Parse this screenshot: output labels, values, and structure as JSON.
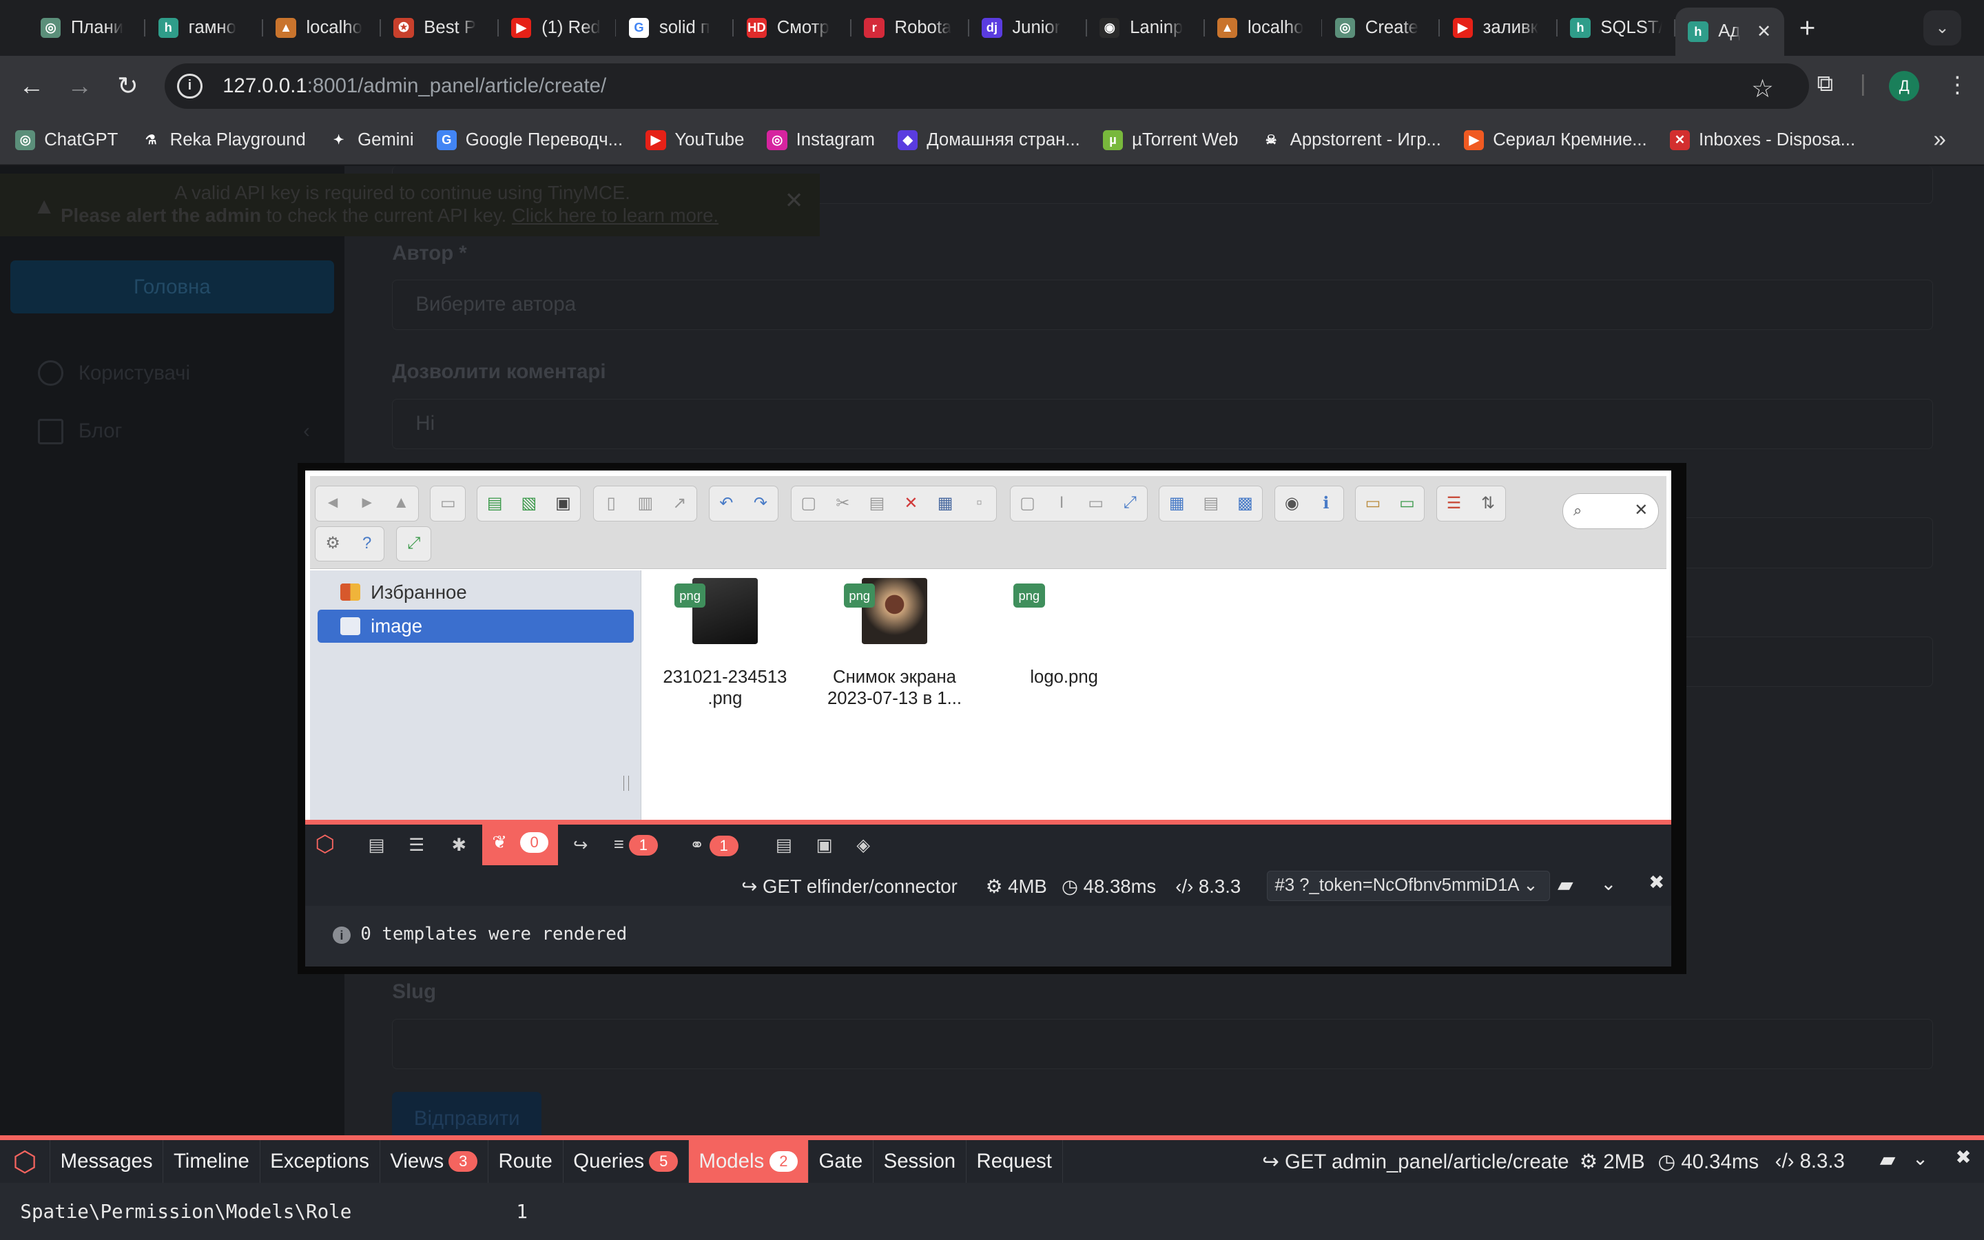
{
  "browser": {
    "tabs": [
      {
        "title": "Плани",
        "color": "#5b8f7a",
        "glyph": "◎"
      },
      {
        "title": "гамно",
        "color": "#2f9d8a",
        "glyph": "h"
      },
      {
        "title": "localho",
        "color": "#c9742d",
        "glyph": "▲"
      },
      {
        "title": "Best P",
        "color": "#c8402c",
        "glyph": "✪"
      },
      {
        "title": "(1) Red",
        "color": "#e62117",
        "glyph": "▶"
      },
      {
        "title": "solid п",
        "color": "#ffffff",
        "glyph": "G"
      },
      {
        "title": "Смотр",
        "color": "#e02b2b",
        "glyph": "HD"
      },
      {
        "title": "Robota",
        "color": "#d42a3a",
        "glyph": "r"
      },
      {
        "title": "Junior",
        "color": "#5a3ce0",
        "glyph": "dj"
      },
      {
        "title": "Laninp",
        "color": "#2b2b2b",
        "glyph": "◉"
      },
      {
        "title": "localho",
        "color": "#c9742d",
        "glyph": "▲"
      },
      {
        "title": "Create",
        "color": "#5b8f7a",
        "glyph": "◎"
      },
      {
        "title": "заливк",
        "color": "#e62117",
        "glyph": "▶"
      },
      {
        "title": "SQLST/",
        "color": "#2f9d8a",
        "glyph": "h"
      },
      {
        "title": "Ад",
        "color": "#2f9d8a",
        "glyph": "h",
        "active": true
      }
    ],
    "close_glyph": "✕",
    "newtab_glyph": "+",
    "url_host": "127.0.0.1",
    "url_rest": ":8001/admin_panel/article/create/",
    "avatar_letter": "Д",
    "bookmarks": [
      {
        "label": "ChatGPT",
        "color": "#5b8f7a",
        "glyph": "◎"
      },
      {
        "label": "Reka Playground",
        "color": "transparent",
        "glyph": "⚗"
      },
      {
        "label": "Gemini",
        "color": "transparent",
        "glyph": "✦"
      },
      {
        "label": "Google Переводч...",
        "color": "#4285f4",
        "glyph": "G"
      },
      {
        "label": "YouTube",
        "color": "#e62117",
        "glyph": "▶"
      },
      {
        "label": "Instagram",
        "color": "#d6249f",
        "glyph": "◎"
      },
      {
        "label": "Домашняя стран...",
        "color": "#5a3ce0",
        "glyph": "◆"
      },
      {
        "label": "µTorrent Web",
        "color": "#78b83c",
        "glyph": "µ"
      },
      {
        "label": "Appstorrent - Игр...",
        "color": "transparent",
        "glyph": "☠"
      },
      {
        "label": "Сериал Кремние...",
        "color": "#f05a22",
        "glyph": "▶"
      },
      {
        "label": "Inboxes - Disposa...",
        "color": "#d32f2f",
        "glyph": "✕"
      }
    ],
    "bookmarks_more": "»"
  },
  "tinymce_warning": {
    "line1": "A valid API key is required to continue using TinyMCE.",
    "line2_bold": "Please alert the admin",
    "line2_rest": " to check the current API key. ",
    "line2_link": "Click here to learn more."
  },
  "sidebar": {
    "home": "Головна",
    "users": "Користувачі",
    "blog": "Блог"
  },
  "form": {
    "author_label": "Автор *",
    "author_placeholder": "Виберите автора",
    "comments_label": "Дозволити коментарі",
    "comments_value": "Ні",
    "slug_label": "Slug",
    "submit": "Відправити"
  },
  "elfinder": {
    "tree": [
      {
        "label": "Избранное",
        "selected": false
      },
      {
        "label": "image",
        "selected": true
      }
    ],
    "files": [
      {
        "name": "231021-234513\n.png",
        "badge": "png",
        "thumb": "dark"
      },
      {
        "name": "Снимок экрана\n2023-07-13 в 1...",
        "badge": "png",
        "thumb": "photo"
      },
      {
        "name": "logo.png",
        "badge": "png",
        "thumb": "none"
      }
    ]
  },
  "inner_debugbar": {
    "views_count": "0",
    "queries_count": "1",
    "models_count": "1",
    "request": "GET elfinder/connector",
    "memory": "4MB",
    "time": "48.38ms",
    "php": "8.3.3",
    "dataset": "#3 ?_token=NcOfbnv5mmiD1A",
    "body": "0 templates were rendered"
  },
  "main_debugbar": {
    "tabs": [
      {
        "label": "Messages"
      },
      {
        "label": "Timeline"
      },
      {
        "label": "Exceptions"
      },
      {
        "label": "Views",
        "badge": "3"
      },
      {
        "label": "Route"
      },
      {
        "label": "Queries",
        "badge": "5"
      },
      {
        "label": "Models",
        "badge": "2",
        "active": true
      },
      {
        "label": "Gate"
      },
      {
        "label": "Session"
      },
      {
        "label": "Request"
      }
    ],
    "request": "GET admin_panel/article/create",
    "memory": "2MB",
    "time": "40.34ms",
    "php": "8.3.3",
    "body_model": "Spatie\\Permission\\Models\\Role",
    "body_count": "1"
  },
  "colors": {
    "accent": "#f4645f",
    "selection": "#3b6fce"
  }
}
